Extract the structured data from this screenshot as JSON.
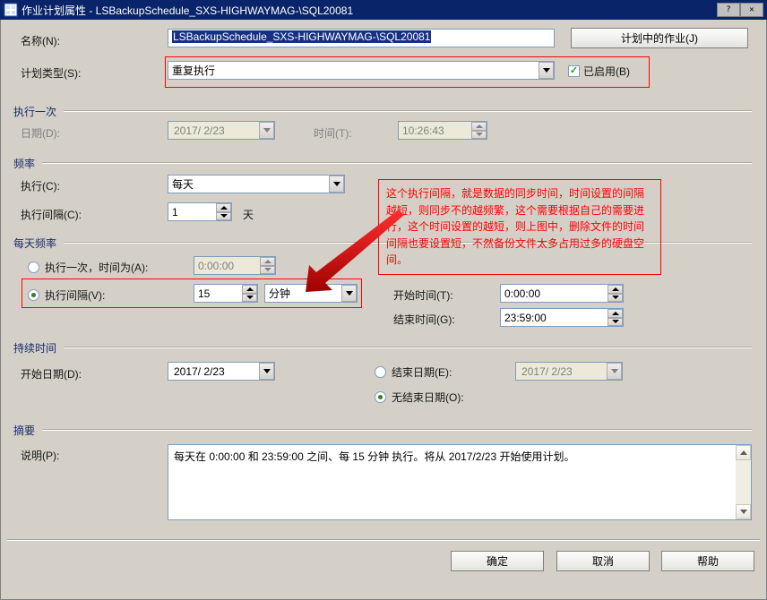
{
  "window": {
    "title": "作业计划属性 - LSBackupSchedule_SXS-HIGHWAYMAG-\\SQL20081"
  },
  "labels": {
    "name": "名称(N):",
    "scheduleType": "计划类型(S):",
    "oneTime": "执行一次",
    "date": "日期(D):",
    "time": "时间(T):",
    "frequency": "频率",
    "execute": "执行(C):",
    "interval": "执行间隔(C):",
    "dailyFreq": "每天频率",
    "onceAt": "执行一次，时间为(A):",
    "repeatEvery": "执行间隔(V):",
    "startTime": "开始时间(T):",
    "endTime": "结束时间(G):",
    "duration": "持续时间",
    "startDate": "开始日期(D):",
    "endDate": "结束日期(E):",
    "noEndDate": "无结束日期(O):",
    "summary": "摘要",
    "description": "说明(P):"
  },
  "name": {
    "value": "LSBackupSchedule_SXS-HIGHWAYMAG-\\SQL20081"
  },
  "header": {
    "jobsInSchedule": "计划中的作业(J)"
  },
  "scheduleType": {
    "value": "重复执行"
  },
  "enabled": {
    "label": "已启用(B)",
    "checked": true
  },
  "oneTime": {
    "date": "2017/ 2/23",
    "time": "10:26:43"
  },
  "frequency": {
    "occurs": "每天",
    "recurs": "1",
    "recursUnit": "天"
  },
  "dailyFreq": {
    "mode": "repeat",
    "onceTime": "0:00:00",
    "repeatValue": "15",
    "repeatUnit": "分钟",
    "startTime": "0:00:00",
    "endTime": "23:59:00"
  },
  "duration": {
    "startDate": "2017/ 2/23",
    "endDateMode": "noend",
    "endDate": "2017/ 2/23"
  },
  "summary": {
    "text": "每天在 0:00:00 和 23:59:00 之间、每 15 分钟 执行。将从 2017/2/23 开始使用计划。"
  },
  "annotation": {
    "text": "这个执行间隔，就是数据的同步时间，时间设置的间隔越短，则同步不的越频繁，这个需要根据自己的需要进行，这个时间设置的越短，则上图中，删除文件的时间间隔也要设置短，不然备份文件太多占用过多的硬盘空间。"
  },
  "buttons": {
    "ok": "确定",
    "cancel": "取消",
    "help": "帮助"
  }
}
